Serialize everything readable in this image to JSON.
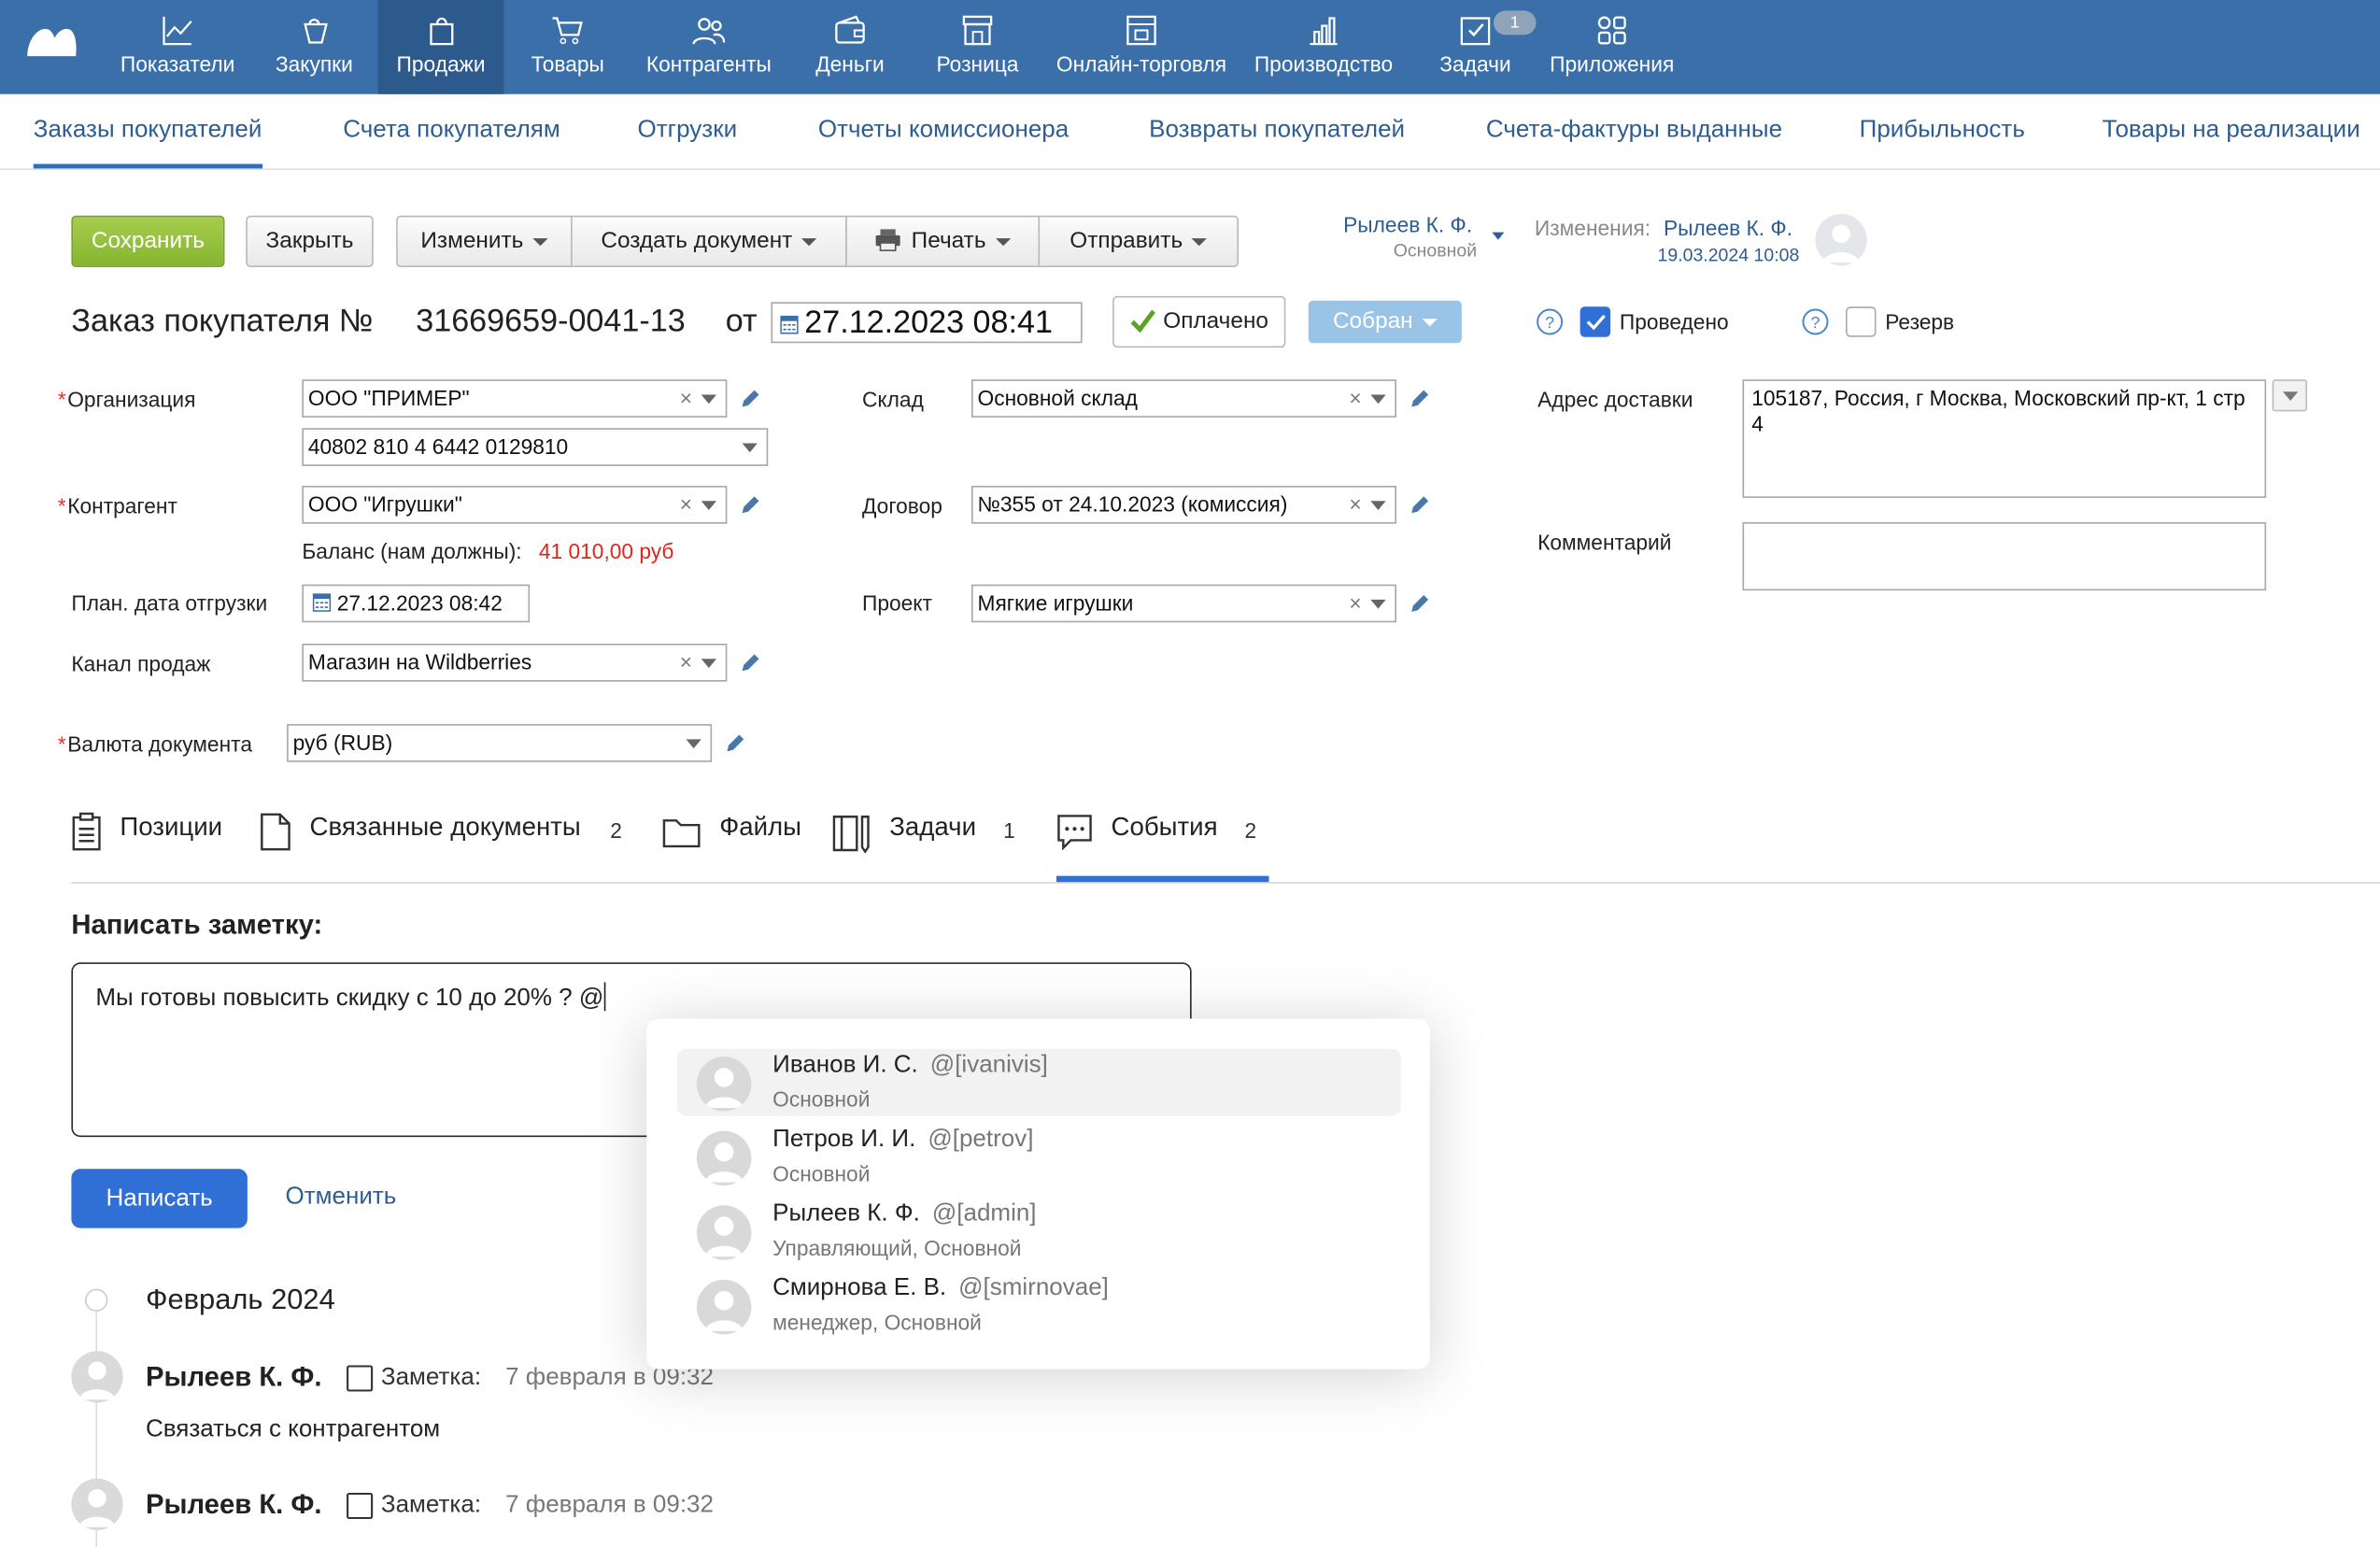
{
  "nav": {
    "items": [
      {
        "label": "Показатели",
        "icon": "chart-icon"
      },
      {
        "label": "Закупки",
        "icon": "bag-icon"
      },
      {
        "label": "Продажи",
        "icon": "shopping-bag-icon"
      },
      {
        "label": "Товары",
        "icon": "cart-icon"
      },
      {
        "label": "Контрагенты",
        "icon": "people-icon"
      },
      {
        "label": "Деньги",
        "icon": "wallet-icon"
      },
      {
        "label": "Розница",
        "icon": "store-icon"
      },
      {
        "label": "Онлайн-торговля",
        "icon": "online-store-icon"
      },
      {
        "label": "Производство",
        "icon": "factory-icon"
      },
      {
        "label": "Задачи",
        "icon": "tasks-icon",
        "badge": "1"
      },
      {
        "label": "Приложения",
        "icon": "apps-icon"
      }
    ],
    "active": "Продажи"
  },
  "subnav": {
    "items": [
      "Заказы покупателей",
      "Счета покупателям",
      "Отгрузки",
      "Отчеты комиссионера",
      "Возвраты покупателей",
      "Счета-фактуры выданные",
      "Прибыльность",
      "Товары на реализации"
    ]
  },
  "toolbar": {
    "save": "Сохранить",
    "close": "Закрыть",
    "edit": "Изменить",
    "create_doc": "Создать документ",
    "print": "Печать",
    "send": "Отправить"
  },
  "owner": {
    "name": "Рылеев К. Ф.",
    "group": "Основной"
  },
  "changes": {
    "label": "Изменения:",
    "name": "Рылеев К. Ф.",
    "date": "19.03.2024 10:08"
  },
  "doc": {
    "title": "Заказ покупателя №",
    "number": "31669659-0041-13",
    "from": "от",
    "datetime": "27.12.2023 08:41",
    "paid": "Оплачено",
    "status": "Собран",
    "posted": "Проведено",
    "reserve": "Резерв"
  },
  "form": {
    "org_label": "Организация",
    "org_value": "ООО \"ПРИМЕР\"",
    "account_value": "40802 810 4 6442 0129810",
    "contractor_label": "Контрагент",
    "contractor_value": "ООО \"Игрушки\"",
    "balance_label": "Баланс (нам должны):",
    "balance_value": "41 010,00 руб",
    "ship_date_label": "План. дата отгрузки",
    "ship_date_value": "27.12.2023 08:42",
    "channel_label": "Канал продаж",
    "channel_value": "Магазин на Wildberries",
    "currency_label": "Валюта документа",
    "currency_value": "руб (RUB)",
    "warehouse_label": "Склад",
    "warehouse_value": "Основной склад",
    "contract_label": "Договор",
    "contract_value": "№355 от 24.10.2023 (комиссия)",
    "project_label": "Проект",
    "project_value": "Мягкие игрушки",
    "address_label": "Адрес доставки",
    "address_value": "105187, Россия, г Москва, Московский пр-кт, 1 стр 4",
    "comment_label": "Комментарий",
    "comment_value": ""
  },
  "tabs": [
    {
      "label": "Позиции",
      "count": ""
    },
    {
      "label": "Связанные документы",
      "count": "2"
    },
    {
      "label": "Файлы",
      "count": ""
    },
    {
      "label": "Задачи",
      "count": "1"
    },
    {
      "label": "События",
      "count": "2"
    }
  ],
  "note": {
    "heading": "Написать заметку:",
    "text": "Мы готовы повысить скидку с 10 до  20% ? @",
    "submit": "Написать",
    "cancel": "Отменить"
  },
  "mentions": [
    {
      "name": "Иванов И. С.",
      "login": "@[ivanivis]",
      "role": "Основной"
    },
    {
      "name": "Петров И. И.",
      "login": "@[petrov]",
      "role": "Основной"
    },
    {
      "name": "Рылеев К. Ф.",
      "login": "@[admin]",
      "role": "Управляющий, Основной"
    },
    {
      "name": "Смирнова Е. В.",
      "login": "@[smirnovae]",
      "role": "менеджер, Основной"
    }
  ],
  "feed": {
    "month": "Февраль 2024",
    "events": [
      {
        "author": "Рылеев К. Ф.",
        "type": "Заметка:",
        "time": "7 февраля в 09:32",
        "text": "Связаться с контрагентом"
      },
      {
        "author": "Рылеев К. Ф.",
        "type": "Заметка:",
        "time": "7 февраля в 09:32",
        "text": ""
      }
    ]
  },
  "colors": {
    "nav_bg": "#3a6fa9",
    "nav_active": "#2c5a8c",
    "link": "#2c5d93",
    "save": "#8dbb38",
    "balance": "#e0261a",
    "submit": "#2f6fd6"
  }
}
